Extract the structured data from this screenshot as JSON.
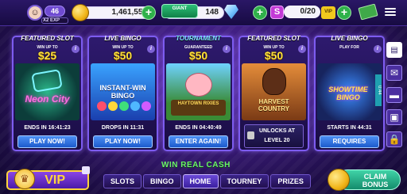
{
  "header": {
    "level": "46",
    "exp_label": "X2 EXP",
    "coins": "1,461,550",
    "giant_badge": "GIANT",
    "gems": "148",
    "tickets": "0/20",
    "ticket_icon_letter": "S",
    "vip_badge": "VIP"
  },
  "cards": [
    {
      "head": "FEATURED SLOT",
      "sub": "WIN UP TO",
      "amount": "$25",
      "status": "ENDS IN 16:41:23",
      "button": "PLAY NOW!",
      "art_text": "Neon City"
    },
    {
      "head": "LIVE BINGO",
      "sub": "WIN UP TO",
      "amount": "$50",
      "status": "DROPS IN 11:31",
      "button": "PLAY NOW!",
      "art_text": "INSTANT-WIN BINGO"
    },
    {
      "head": "TOURNAMENT",
      "sub": "GUARANTEED",
      "amount": "$50",
      "status": "ENDS IN 04:40:49",
      "button": "ENTER AGAIN!",
      "art_text": "HAYTOWN RIXIES"
    },
    {
      "head": "FEATURED SLOT",
      "sub": "WIN UP TO",
      "amount": "$50",
      "status": "",
      "button": "UNLOCKS AT LEVEL 20",
      "art_text": "HARVEST COUNTRY"
    },
    {
      "head": "LIVE BINGO",
      "sub": "PLAY FOR",
      "amount": "",
      "status": "STARTS IN 44:31",
      "button": "REQUIRES",
      "art_text": "SHOWTIME BINGO",
      "timer": "0:44"
    }
  ],
  "bottom": {
    "win_real": "WIN REAL CASH",
    "vip": "VIP",
    "tabs": [
      "SLOTS",
      "BINGO",
      "HOME",
      "TOURNEY",
      "PRIZES"
    ],
    "active_tab": "HOME",
    "claim": "CLAIM",
    "bonus": "BONUS"
  }
}
